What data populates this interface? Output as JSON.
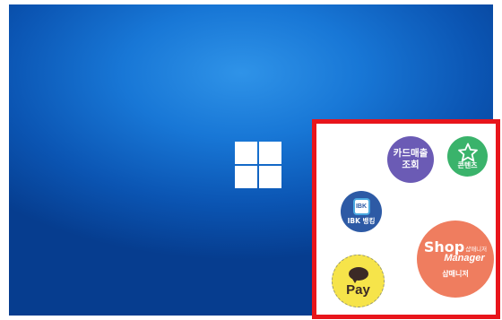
{
  "desktop": {
    "logo_icon": "windows-logo-icon",
    "background_color": "#1877d6"
  },
  "launcher": {
    "border_color": "#e8151b",
    "apps": {
      "card_sales": {
        "label_line1": "카드매출",
        "label_line2": "조회",
        "color": "#6b5bb5"
      },
      "contents": {
        "label": "콘텐츠",
        "icon": "star-icon",
        "color": "#3ab36b"
      },
      "ibk_banking": {
        "label": "IBK 뱅킹",
        "icon_text": "IBK",
        "color": "#2d5aa5"
      },
      "shop_manager": {
        "brand_big": "Shop",
        "brand_small": "샵매니저",
        "brand_line2": "Manager",
        "label": "샵매니저",
        "color": "#ef7d5f"
      },
      "kakao_pay": {
        "label": "Pay",
        "icon": "speech-bubble-icon",
        "color": "#f6e44a"
      }
    }
  }
}
